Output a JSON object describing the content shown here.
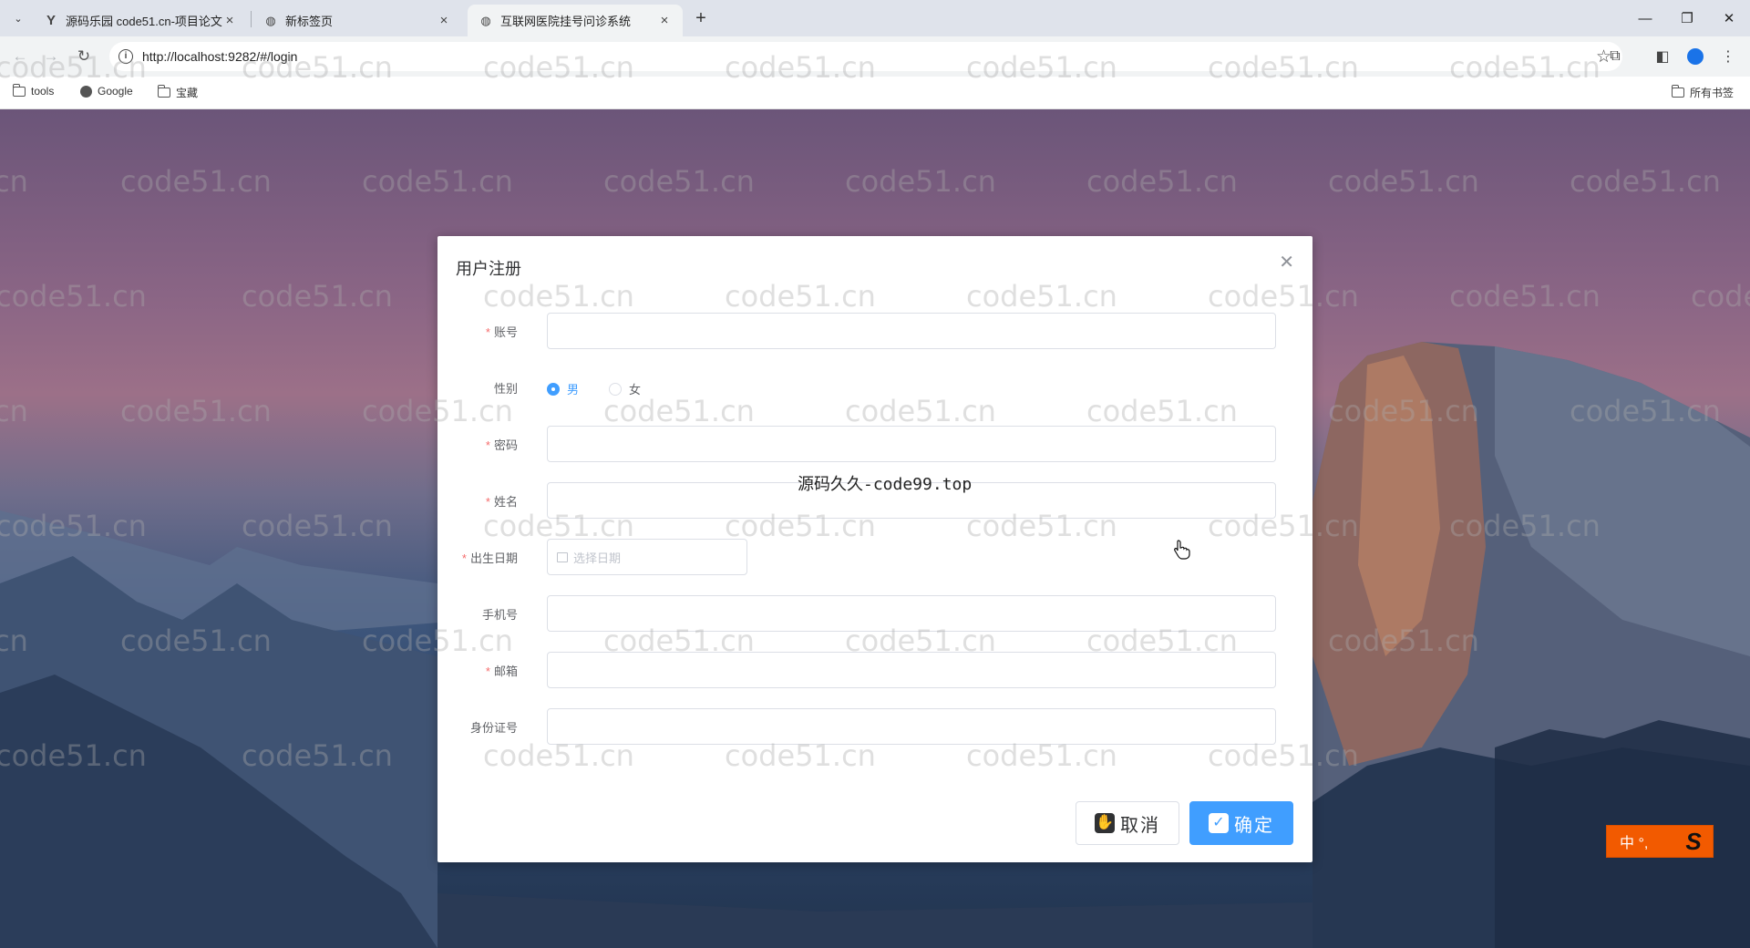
{
  "browser": {
    "tabs": [
      {
        "title": "源码乐园 code51.cn-项目论文",
        "favicon": "y-logo-icon",
        "active": false
      },
      {
        "title": "新标签页",
        "favicon": "globe-icon",
        "active": false
      },
      {
        "title": "互联网医院挂号问诊系统",
        "favicon": "globe-icon",
        "active": true
      }
    ],
    "url": "http://localhost:9282/#/login",
    "bookmarks": [
      {
        "label": "tools",
        "icon": "folder-icon"
      },
      {
        "label": "Google",
        "icon": "globe-icon"
      },
      {
        "label": "宝藏",
        "icon": "folder-icon"
      }
    ],
    "all_bookmarks_label": "所有书签"
  },
  "watermark": {
    "text": "code51.cn"
  },
  "overlay_text": "源码久久-code99.top",
  "dialog": {
    "title": "用户注册",
    "fields": [
      {
        "label": "账号",
        "required": true,
        "type": "text",
        "value": ""
      },
      {
        "label": "性别",
        "required": false,
        "type": "radio",
        "options": [
          "男",
          "女"
        ],
        "selected": "男"
      },
      {
        "label": "密码",
        "required": true,
        "type": "password",
        "value": ""
      },
      {
        "label": "姓名",
        "required": true,
        "type": "text",
        "value": ""
      },
      {
        "label": "出生日期",
        "required": true,
        "type": "date",
        "placeholder": "选择日期"
      },
      {
        "label": "手机号",
        "required": false,
        "type": "text",
        "value": ""
      },
      {
        "label": "邮箱",
        "required": true,
        "type": "text",
        "value": ""
      },
      {
        "label": "身份证号",
        "required": false,
        "type": "text",
        "value": ""
      }
    ],
    "cancel_label": "取消",
    "confirm_label": "确定"
  },
  "ime": {
    "label": "中 °,"
  },
  "colors": {
    "primary": "#409eff",
    "required": "#f56c6c",
    "ime": "#f25a00"
  }
}
